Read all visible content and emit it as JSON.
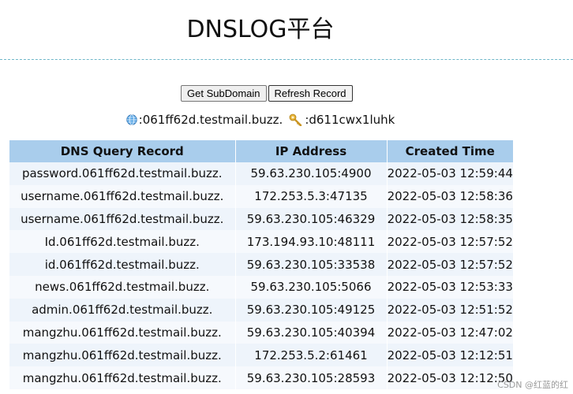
{
  "page": {
    "title": "DNSLOG平台"
  },
  "buttons": {
    "get_subdomain": "Get SubDomain",
    "refresh_record": "Refresh Record"
  },
  "info": {
    "subdomain": ":061ff62d.testmail.buzz.",
    "token": ":d611cwx1luhk"
  },
  "table": {
    "headers": [
      "DNS Query Record",
      "IP Address",
      "Created Time"
    ],
    "rows": [
      [
        "password.061ff62d.testmail.buzz.",
        "59.63.230.105:4900",
        "2022-05-03 12:59:44"
      ],
      [
        "username.061ff62d.testmail.buzz.",
        "172.253.5.3:47135",
        "2022-05-03 12:58:36"
      ],
      [
        "username.061ff62d.testmail.buzz.",
        "59.63.230.105:46329",
        "2022-05-03 12:58:35"
      ],
      [
        "Id.061ff62d.testmail.buzz.",
        "173.194.93.10:48111",
        "2022-05-03 12:57:52"
      ],
      [
        "id.061ff62d.testmail.buzz.",
        "59.63.230.105:33538",
        "2022-05-03 12:57:52"
      ],
      [
        "news.061ff62d.testmail.buzz.",
        "59.63.230.105:5066",
        "2022-05-03 12:53:33"
      ],
      [
        "admin.061ff62d.testmail.buzz.",
        "59.63.230.105:49125",
        "2022-05-03 12:51:52"
      ],
      [
        "mangzhu.061ff62d.testmail.buzz.",
        "59.63.230.105:40394",
        "2022-05-03 12:47:02"
      ],
      [
        "mangzhu.061ff62d.testmail.buzz.",
        "172.253.5.2:61461",
        "2022-05-03 12:12:51"
      ],
      [
        "mangzhu.061ff62d.testmail.buzz.",
        "59.63.230.105:28593",
        "2022-05-03 12:12:50"
      ]
    ]
  },
  "watermark": "CSDN @红蓝的红",
  "icons": {
    "subdomain": "globe-icon",
    "token": "key-icon"
  },
  "colors": {
    "header_bg": "#a9cdec",
    "row_bg": "#eef4fb",
    "divider": "#6fb7c9"
  }
}
